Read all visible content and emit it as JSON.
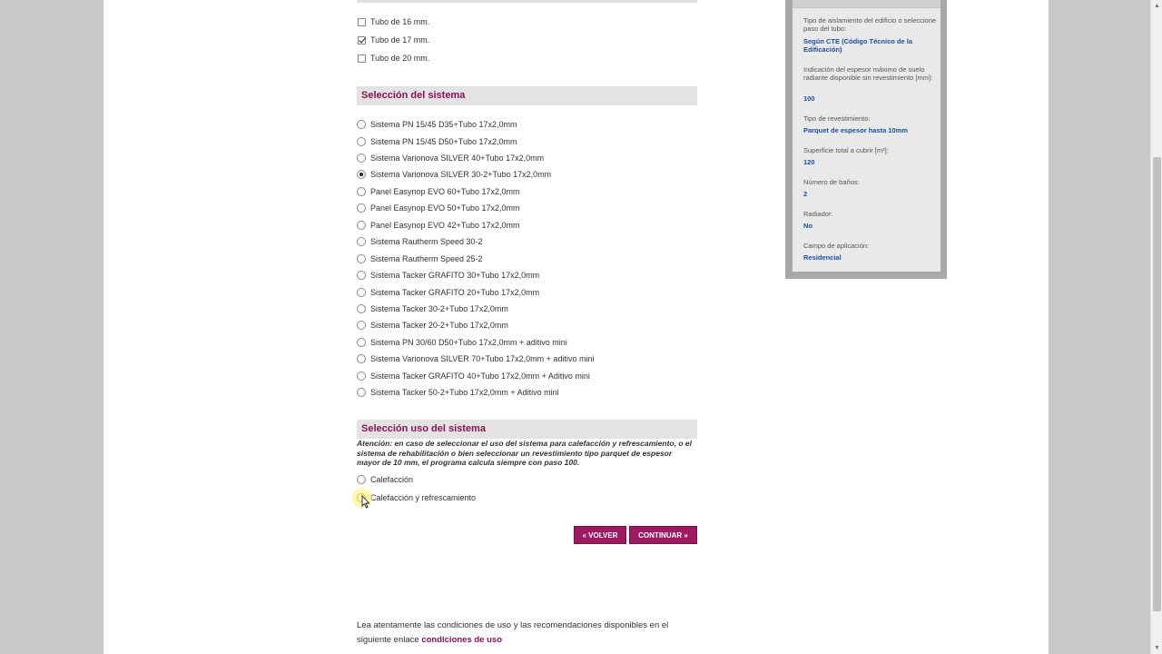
{
  "tube_options": [
    {
      "label": "Tubo de 16 mm.",
      "checked": false
    },
    {
      "label": "Tubo de 17 mm.",
      "checked": true
    },
    {
      "label": "Tubo de 20 mm.",
      "checked": false
    }
  ],
  "system_section": {
    "title": "Selección del sistema",
    "options": [
      {
        "label": "Sistema PN 15/45 D35+Tubo 17x2,0mm",
        "checked": false
      },
      {
        "label": "Sistema PN 15/45 D50+Tubo 17x2,0mm",
        "checked": false
      },
      {
        "label": "Sistema Varionova SILVER 40+Tubo 17x2,0mm",
        "checked": false
      },
      {
        "label": "Sistema Varionova SILVER 30-2+Tubo 17x2,0mm",
        "checked": true
      },
      {
        "label": "Panel Easynop EVO 60+Tubo 17x2,0mm",
        "checked": false
      },
      {
        "label": "Panel Easynop EVO 50+Tubo 17x2,0mm",
        "checked": false
      },
      {
        "label": "Panel Easynop EVO 42+Tubo 17x2,0mm",
        "checked": false
      },
      {
        "label": "Sistema Rautherm Speed 30-2",
        "checked": false
      },
      {
        "label": "Sistema Rautherm Speed 25-2",
        "checked": false
      },
      {
        "label": "Sistema Tacker GRAFITO 30+Tubo 17x2,0mm",
        "checked": false
      },
      {
        "label": "Sistema Tacker GRAFITO 20+Tubo 17x2,0mm",
        "checked": false
      },
      {
        "label": "Sistema Tacker 30-2+Tubo 17x2,0mm",
        "checked": false
      },
      {
        "label": "Sistema Tacker 20-2+Tubo 17x2,0mm",
        "checked": false
      },
      {
        "label": "Sistema PN 30/60 D50+Tubo 17x2,0mm + aditivo mini",
        "checked": false
      },
      {
        "label": "Sistema Varionova SILVER 70+Tubo 17x2,0mm + aditivo mini",
        "checked": false
      },
      {
        "label": "Sistema Tacker GRAFITO 40+Tubo 17x2,0mm + Aditivo mini",
        "checked": false
      },
      {
        "label": "Sistema Tacker 50-2+Tubo 17x2,0mm + Aditivo mini",
        "checked": false
      }
    ]
  },
  "use_section": {
    "title": "Selección uso del sistema",
    "attention": "Atención: en caso de seleccionar el uso del sistema para calefacción y refrescamiento, o el sistema de rehabilitación o bien seleccionar un revestimiento tipo parquet de espesor mayor de 10 mm, el programa calcula siempre con paso 100.",
    "options": [
      {
        "label": "Calefacción",
        "checked": false
      },
      {
        "label": "Calefacción y refrescamiento",
        "checked": false
      }
    ]
  },
  "buttons": {
    "back": "« VOLVER",
    "next": "CONTINUAR »"
  },
  "footer": {
    "text": "Lea atentamente las condiciones de uso y las recomendaciones disponibles en el siguiente enlace",
    "link": "condiciones de uso"
  },
  "sidebar": {
    "fields": [
      {
        "label": "Tipo de aislamiento del edificio o seleccione paso del tubo:",
        "value": "Según CTE (Código Técnico de la Edificación)"
      },
      {
        "label": "Indicación del espesor máximo de suelo radiante disponible sin revestimiento [mm]:",
        "value": "100"
      },
      {
        "label": "Tipo de revestimiento:",
        "value": "Parquet de espesor hasta 10mm"
      },
      {
        "label": "Superficie total a cubrir [m²]:",
        "value": "120"
      },
      {
        "label": "Número de baños:",
        "value": "2"
      },
      {
        "label": "Radiador:",
        "value": "No"
      },
      {
        "label": "Campo de aplicación:",
        "value": "Residencial"
      }
    ]
  },
  "colors": {
    "accent": "#8a1457",
    "button": "#9b1a62",
    "sidebar_value": "#1a4fa0"
  }
}
